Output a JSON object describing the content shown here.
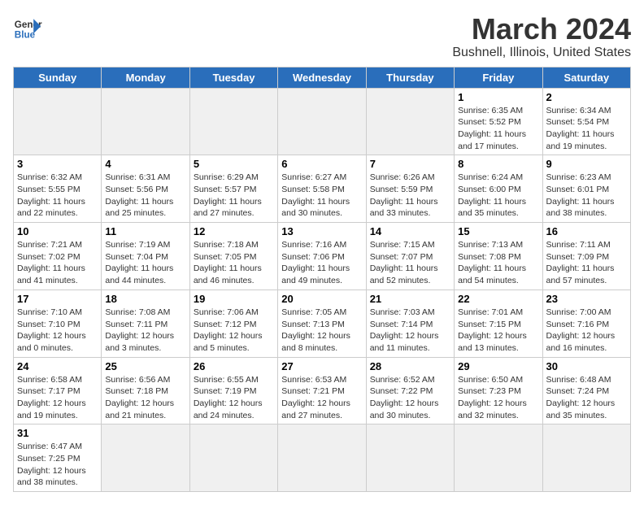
{
  "header": {
    "logo_line1": "General",
    "logo_line2": "Blue",
    "title": "March 2024",
    "subtitle": "Bushnell, Illinois, United States"
  },
  "weekdays": [
    "Sunday",
    "Monday",
    "Tuesday",
    "Wednesday",
    "Thursday",
    "Friday",
    "Saturday"
  ],
  "weeks": [
    [
      {
        "day": "",
        "info": ""
      },
      {
        "day": "",
        "info": ""
      },
      {
        "day": "",
        "info": ""
      },
      {
        "day": "",
        "info": ""
      },
      {
        "day": "",
        "info": ""
      },
      {
        "day": "1",
        "info": "Sunrise: 6:35 AM\nSunset: 5:52 PM\nDaylight: 11 hours and 17 minutes."
      },
      {
        "day": "2",
        "info": "Sunrise: 6:34 AM\nSunset: 5:54 PM\nDaylight: 11 hours and 19 minutes."
      }
    ],
    [
      {
        "day": "3",
        "info": "Sunrise: 6:32 AM\nSunset: 5:55 PM\nDaylight: 11 hours and 22 minutes."
      },
      {
        "day": "4",
        "info": "Sunrise: 6:31 AM\nSunset: 5:56 PM\nDaylight: 11 hours and 25 minutes."
      },
      {
        "day": "5",
        "info": "Sunrise: 6:29 AM\nSunset: 5:57 PM\nDaylight: 11 hours and 27 minutes."
      },
      {
        "day": "6",
        "info": "Sunrise: 6:27 AM\nSunset: 5:58 PM\nDaylight: 11 hours and 30 minutes."
      },
      {
        "day": "7",
        "info": "Sunrise: 6:26 AM\nSunset: 5:59 PM\nDaylight: 11 hours and 33 minutes."
      },
      {
        "day": "8",
        "info": "Sunrise: 6:24 AM\nSunset: 6:00 PM\nDaylight: 11 hours and 35 minutes."
      },
      {
        "day": "9",
        "info": "Sunrise: 6:23 AM\nSunset: 6:01 PM\nDaylight: 11 hours and 38 minutes."
      }
    ],
    [
      {
        "day": "10",
        "info": "Sunrise: 7:21 AM\nSunset: 7:02 PM\nDaylight: 11 hours and 41 minutes."
      },
      {
        "day": "11",
        "info": "Sunrise: 7:19 AM\nSunset: 7:04 PM\nDaylight: 11 hours and 44 minutes."
      },
      {
        "day": "12",
        "info": "Sunrise: 7:18 AM\nSunset: 7:05 PM\nDaylight: 11 hours and 46 minutes."
      },
      {
        "day": "13",
        "info": "Sunrise: 7:16 AM\nSunset: 7:06 PM\nDaylight: 11 hours and 49 minutes."
      },
      {
        "day": "14",
        "info": "Sunrise: 7:15 AM\nSunset: 7:07 PM\nDaylight: 11 hours and 52 minutes."
      },
      {
        "day": "15",
        "info": "Sunrise: 7:13 AM\nSunset: 7:08 PM\nDaylight: 11 hours and 54 minutes."
      },
      {
        "day": "16",
        "info": "Sunrise: 7:11 AM\nSunset: 7:09 PM\nDaylight: 11 hours and 57 minutes."
      }
    ],
    [
      {
        "day": "17",
        "info": "Sunrise: 7:10 AM\nSunset: 7:10 PM\nDaylight: 12 hours and 0 minutes."
      },
      {
        "day": "18",
        "info": "Sunrise: 7:08 AM\nSunset: 7:11 PM\nDaylight: 12 hours and 3 minutes."
      },
      {
        "day": "19",
        "info": "Sunrise: 7:06 AM\nSunset: 7:12 PM\nDaylight: 12 hours and 5 minutes."
      },
      {
        "day": "20",
        "info": "Sunrise: 7:05 AM\nSunset: 7:13 PM\nDaylight: 12 hours and 8 minutes."
      },
      {
        "day": "21",
        "info": "Sunrise: 7:03 AM\nSunset: 7:14 PM\nDaylight: 12 hours and 11 minutes."
      },
      {
        "day": "22",
        "info": "Sunrise: 7:01 AM\nSunset: 7:15 PM\nDaylight: 12 hours and 13 minutes."
      },
      {
        "day": "23",
        "info": "Sunrise: 7:00 AM\nSunset: 7:16 PM\nDaylight: 12 hours and 16 minutes."
      }
    ],
    [
      {
        "day": "24",
        "info": "Sunrise: 6:58 AM\nSunset: 7:17 PM\nDaylight: 12 hours and 19 minutes."
      },
      {
        "day": "25",
        "info": "Sunrise: 6:56 AM\nSunset: 7:18 PM\nDaylight: 12 hours and 21 minutes."
      },
      {
        "day": "26",
        "info": "Sunrise: 6:55 AM\nSunset: 7:19 PM\nDaylight: 12 hours and 24 minutes."
      },
      {
        "day": "27",
        "info": "Sunrise: 6:53 AM\nSunset: 7:21 PM\nDaylight: 12 hours and 27 minutes."
      },
      {
        "day": "28",
        "info": "Sunrise: 6:52 AM\nSunset: 7:22 PM\nDaylight: 12 hours and 30 minutes."
      },
      {
        "day": "29",
        "info": "Sunrise: 6:50 AM\nSunset: 7:23 PM\nDaylight: 12 hours and 32 minutes."
      },
      {
        "day": "30",
        "info": "Sunrise: 6:48 AM\nSunset: 7:24 PM\nDaylight: 12 hours and 35 minutes."
      }
    ],
    [
      {
        "day": "31",
        "info": "Sunrise: 6:47 AM\nSunset: 7:25 PM\nDaylight: 12 hours and 38 minutes."
      },
      {
        "day": "",
        "info": ""
      },
      {
        "day": "",
        "info": ""
      },
      {
        "day": "",
        "info": ""
      },
      {
        "day": "",
        "info": ""
      },
      {
        "day": "",
        "info": ""
      },
      {
        "day": "",
        "info": ""
      }
    ]
  ]
}
